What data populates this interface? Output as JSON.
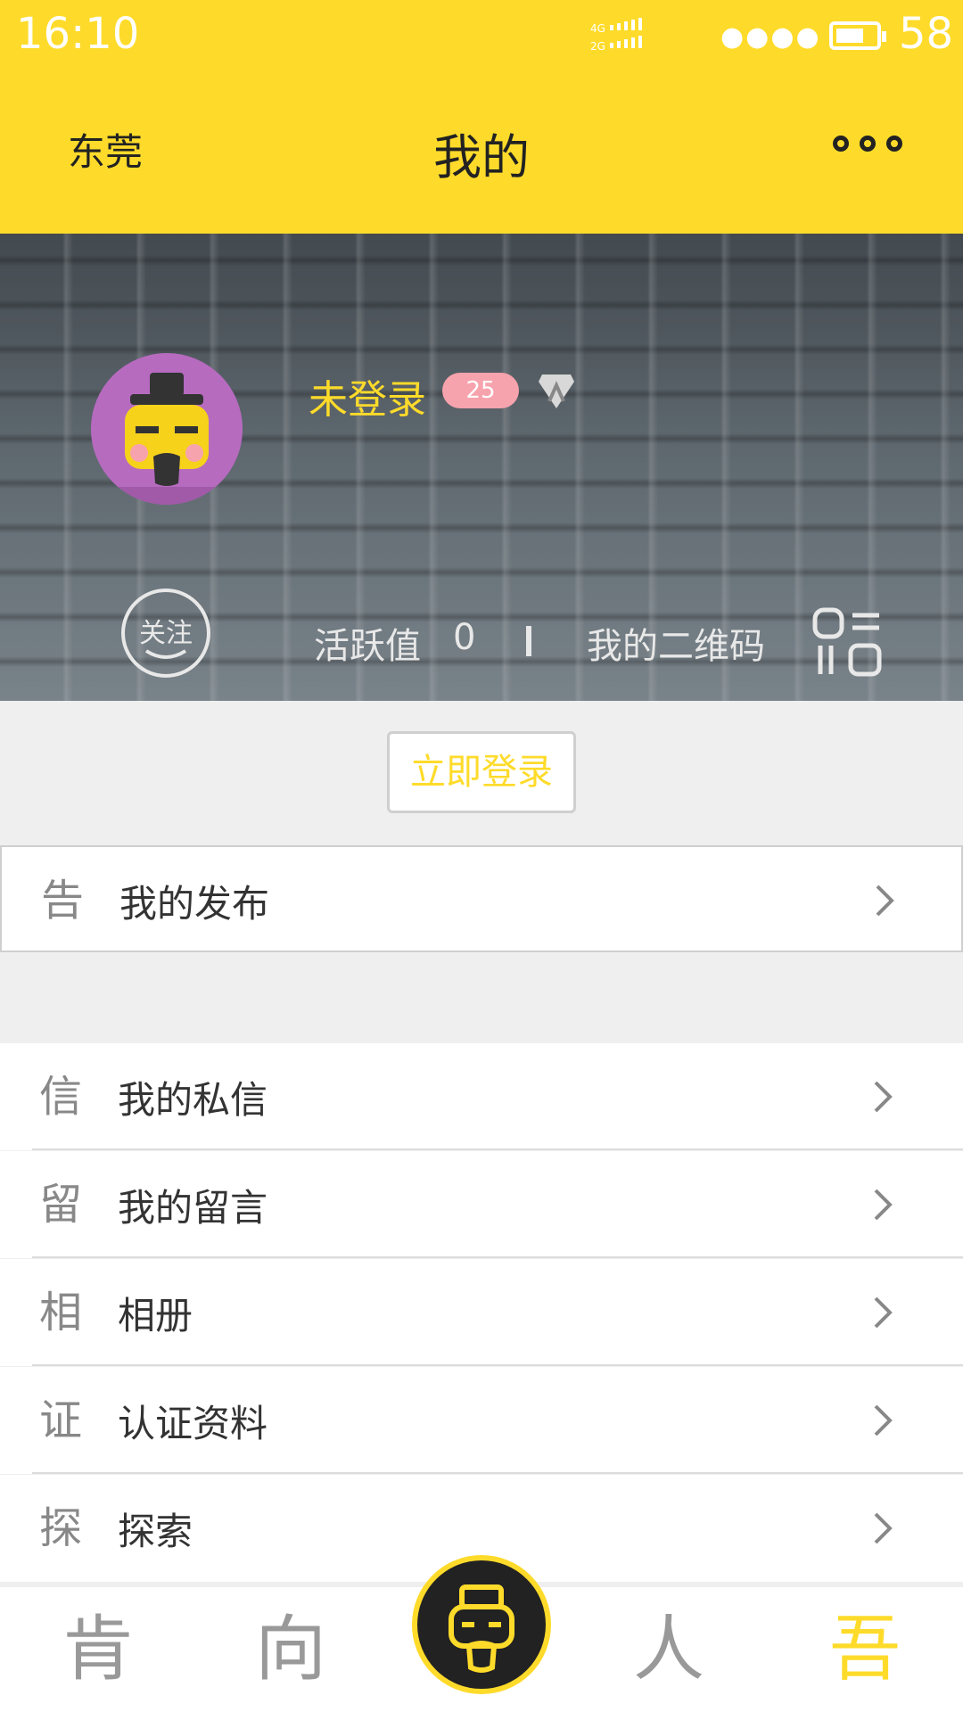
{
  "status_bar": {
    "time": "16:10",
    "battery_level": "58",
    "signal_text": "4G 2G"
  },
  "header": {
    "city": "东莞",
    "title": "我的"
  },
  "profile": {
    "nickname": "未登录",
    "level_badge": "25",
    "activity_label": "活跃值",
    "activity_value": "0",
    "qr_label": "我的二维码",
    "follow_icon_text": "关注"
  },
  "login_button": "立即登录",
  "menu_primary": [
    {
      "icon_char": "告",
      "label": "我的发布"
    }
  ],
  "menu_secondary": [
    {
      "icon_char": "信",
      "label": "我的私信"
    },
    {
      "icon_char": "留",
      "label": "我的留言"
    },
    {
      "icon_char": "相",
      "label": "相册"
    },
    {
      "icon_char": "证",
      "label": "认证资料"
    },
    {
      "icon_char": "探",
      "label": "探索"
    }
  ],
  "tabbar": {
    "tabs": [
      {
        "char": "肯",
        "active": false
      },
      {
        "char": "向",
        "active": false
      },
      {
        "char": "",
        "active": false
      },
      {
        "char": "人",
        "active": false
      },
      {
        "char": "吾",
        "active": true
      }
    ]
  },
  "colors": {
    "brand_yellow": "#fedb2a",
    "badge_pink": "#f7a3ad",
    "avatar_purple": "#b66bbf"
  },
  "icons": {
    "more": "more-dots-icon",
    "arrow": "chevron-right-icon",
    "qr": "qr-code-icon",
    "cert": "certification-icon",
    "signal": "signal-icon",
    "battery": "battery-icon"
  }
}
